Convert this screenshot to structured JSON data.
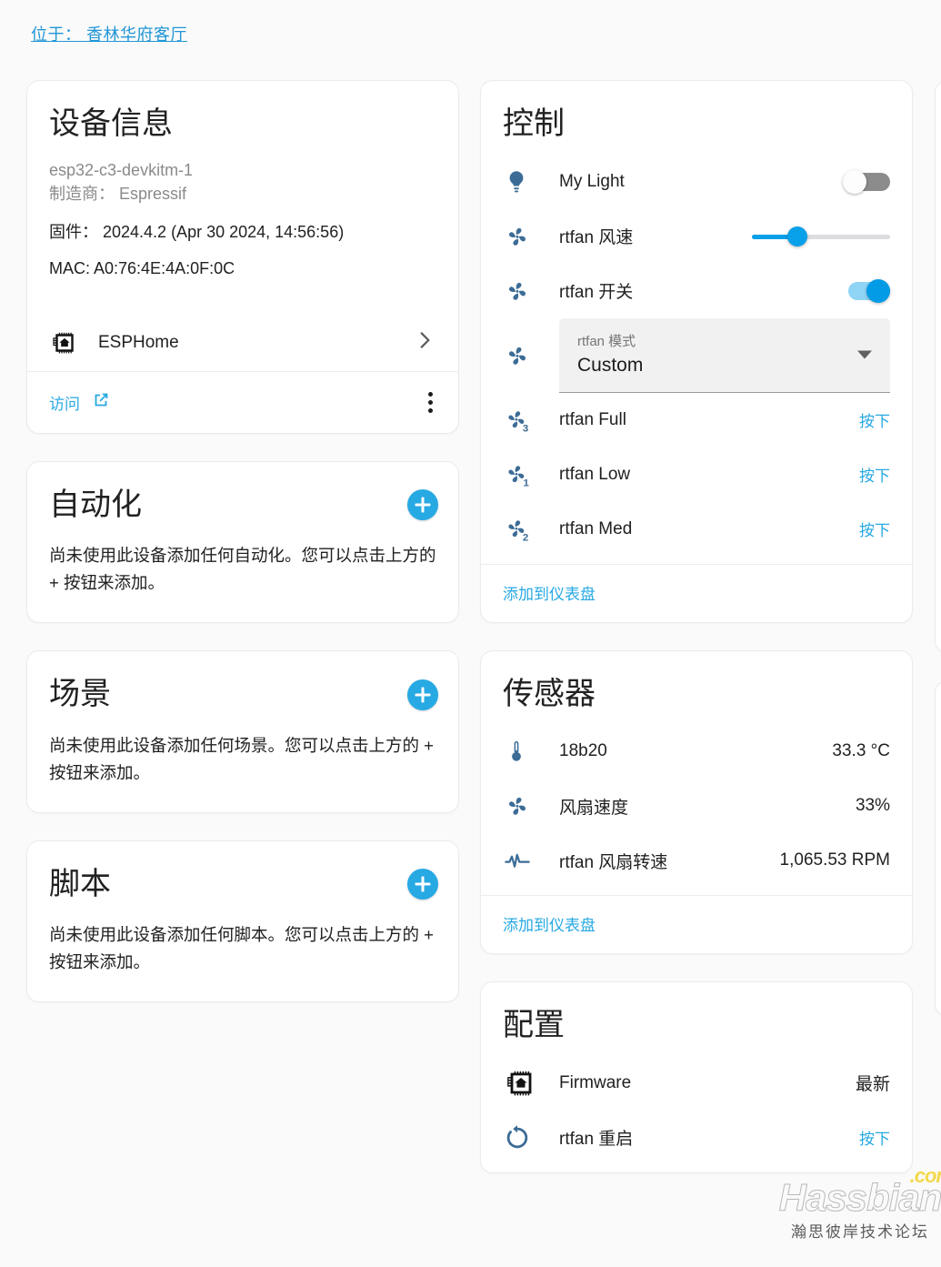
{
  "header": {
    "area_label": "位于：",
    "area_name": "香林华府客厅",
    "area_full": "位于： 香林华府客厅",
    "link_color": "#2196d6"
  },
  "theme": {
    "background": "#fafafa",
    "card_background": "#ffffff",
    "accent": "#27a9e3",
    "toggle_on": "#039be5",
    "toggle_on_track": "#8fd4f5",
    "toggle_off_track": "#8c8c8c",
    "slider_fill": "#09a0ea",
    "icon_blue": "#3c6c96",
    "text_primary": "#212121",
    "text_secondary": "#8a8a8a"
  },
  "device_info": {
    "title": "设备信息",
    "model": "esp32-c3-devkitm-1",
    "manufacturer": "制造商： Espressif",
    "firmware": "固件： 2024.4.2 (Apr 30 2024, 14:56:56)",
    "mac": "MAC: A0:76:4E:4A:0F:0C",
    "integration": {
      "icon": "chip-home-icon",
      "label": "ESPHome",
      "chevron": "chevron-right-icon"
    },
    "visit_link": "访问",
    "visit_icon": "open-in-new-icon",
    "overflow_icon": "more-vertical-icon"
  },
  "automations": {
    "title": "自动化",
    "add_icon": "plus-circle-icon",
    "empty_text": "尚未使用此设备添加任何自动化。您可以点击上方的 + 按钮来添加。"
  },
  "scenes": {
    "title": "场景",
    "add_icon": "plus-circle-icon",
    "empty_text": "尚未使用此设备添加任何场景。您可以点击上方的 + 按钮来添加。"
  },
  "scripts": {
    "title": "脚本",
    "add_icon": "plus-circle-icon",
    "empty_text": "尚未使用此设备添加任何脚本。您可以点击上方的 + 按钮来添加。"
  },
  "controls": {
    "title": "控制",
    "footer_link": "添加到仪表盘",
    "rows": [
      {
        "icon": "lightbulb-icon",
        "name": "My Light",
        "control": "toggle",
        "state": "off"
      },
      {
        "icon": "fan-icon",
        "name": "rtfan 风速",
        "control": "slider",
        "percent": 33
      },
      {
        "icon": "fan-icon",
        "name": "rtfan 开关",
        "control": "toggle",
        "state": "on"
      },
      {
        "icon": "fan-icon",
        "name": "rtfan 模式",
        "control": "select",
        "select_label": "rtfan 模式",
        "select_value": "Custom",
        "caret": "chevron-down-icon"
      },
      {
        "icon": "fan-speed-3-icon",
        "name": "rtfan Full",
        "control": "button",
        "action": "按下"
      },
      {
        "icon": "fan-speed-1-icon",
        "name": "rtfan Low",
        "control": "button",
        "action": "按下"
      },
      {
        "icon": "fan-speed-2-icon",
        "name": "rtfan Med",
        "control": "button",
        "action": "按下"
      }
    ]
  },
  "sensors": {
    "title": "传感器",
    "footer_link": "添加到仪表盘",
    "rows": [
      {
        "icon": "thermometer-icon",
        "name": "18b20",
        "value": "33.3 °C"
      },
      {
        "icon": "fan-icon",
        "name": "风扇速度",
        "value": "33%"
      },
      {
        "icon": "pulse-icon",
        "name": "rtfan 风扇转速",
        "value": "1,065.53 RPM"
      }
    ]
  },
  "configuration": {
    "title": "配置",
    "rows": [
      {
        "icon": "chip-home-icon",
        "name": "Firmware",
        "value": "最新",
        "type": "status"
      },
      {
        "icon": "restart-icon",
        "name": "rtfan 重启",
        "value": "按下",
        "type": "button"
      }
    ]
  },
  "watermark": {
    "brand": "Hassbian",
    "tld": ".com",
    "subtitle": "瀚思彼岸技术论坛"
  }
}
